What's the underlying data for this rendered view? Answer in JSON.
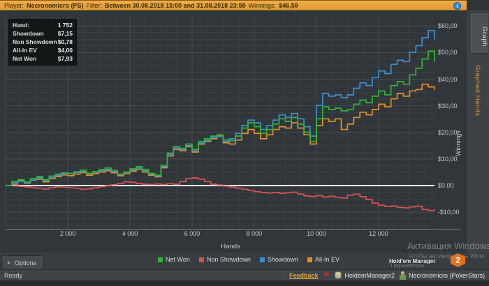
{
  "header": {
    "player_label": "Player:",
    "player_value": "Necronomicro (PS)",
    "filter_label": "Filter:",
    "filter_value": "Between 30.08.2018 15:00 and 31.08.2018 23:59",
    "winnings_label": "Winnings:",
    "winnings_value": "$46,59",
    "info_icon": "i"
  },
  "sidebar": {
    "tabs": [
      {
        "label": "Graph"
      },
      {
        "label": "Graphed Hands"
      }
    ]
  },
  "tooltip": {
    "rows": [
      {
        "label": "Hand:",
        "value": "1 752"
      },
      {
        "label": "Showdown",
        "value": "$7,15"
      },
      {
        "label": "Non Showdown",
        "value": "$0,78"
      },
      {
        "label": "All-In EV",
        "value": "$4,00"
      },
      {
        "label": "Net Won",
        "value": "$7,93"
      }
    ]
  },
  "chart_data": {
    "type": "line",
    "xlabel": "Hands",
    "ylabel": "Winnings",
    "xlim": [
      0,
      13800
    ],
    "ylim": [
      -16,
      64
    ],
    "x_ticks": [
      2000,
      4000,
      6000,
      8000,
      10000,
      12000
    ],
    "x_tick_labels": [
      "2 000",
      "4 000",
      "6 000",
      "8 000",
      "10 000",
      "12 000"
    ],
    "y_ticks": [
      60,
      50,
      40,
      30,
      20,
      10,
      0,
      -10
    ],
    "y_tick_labels": [
      "$60,00",
      "$50,00",
      "$40,00",
      "$30,00",
      "$20,00",
      "$10,00",
      "$0,00",
      "-$10,00"
    ],
    "x_minor_step": 500,
    "y_minor_step": 2.5,
    "grid": true,
    "legend_position": "bottom",
    "zero_line_color": "#ffffff",
    "colors": {
      "grid_minor": "#3a4045",
      "grid_major": "#454c51",
      "axis": "#7b8286"
    },
    "draw_order": [
      1,
      3,
      2,
      0
    ],
    "x": [
      0,
      200,
      400,
      600,
      800,
      1000,
      1200,
      1400,
      1600,
      1800,
      2000,
      2200,
      2400,
      2600,
      2800,
      3000,
      3200,
      3400,
      3600,
      3800,
      4000,
      4200,
      4400,
      4600,
      4800,
      5000,
      5200,
      5400,
      5600,
      5800,
      6000,
      6200,
      6400,
      6600,
      6800,
      7000,
      7200,
      7400,
      7600,
      7800,
      8000,
      8200,
      8400,
      8600,
      8800,
      9000,
      9200,
      9400,
      9600,
      9800,
      10000,
      10200,
      10400,
      10600,
      10800,
      11000,
      11200,
      11400,
      11600,
      11800,
      12000,
      12200,
      12400,
      12600,
      12800,
      13000,
      13200,
      13400,
      13600,
      13800
    ],
    "series": [
      {
        "name": "Net Won",
        "color": "#2eb535",
        "values": [
          0,
          1.5,
          2.2,
          1.4,
          2.6,
          3.4,
          2.2,
          3.6,
          4.3,
          4.8,
          4.4,
          5.2,
          5.8,
          4.6,
          5.3,
          6.0,
          6.6,
          5.6,
          4.3,
          5.1,
          6.3,
          7.1,
          6.1,
          4.6,
          3.9,
          7.6,
          12.2,
          14.6,
          14.0,
          15.6,
          13.6,
          16.6,
          17.6,
          18.6,
          19.1,
          17.1,
          16.9,
          18.6,
          21.6,
          23.6,
          22.1,
          19.6,
          21.1,
          23.1,
          25.1,
          24.1,
          25.6,
          23.1,
          20.1,
          16.6,
          25.1,
          29.6,
          28.6,
          29.1,
          28.1,
          28.6,
          30.6,
          32.1,
          31.1,
          33.6,
          35.6,
          34.1,
          37.6,
          39.1,
          38.1,
          41.6,
          44.1,
          47.6,
          50.6,
          46.5
        ]
      },
      {
        "name": "Non Showdown",
        "color": "#d95252",
        "values": [
          0,
          0.3,
          -0.3,
          -0.5,
          -0.8,
          -1.0,
          -1.3,
          -0.8,
          -0.5,
          -0.6,
          -0.8,
          -1.0,
          -1.4,
          -1.2,
          -0.8,
          -0.4,
          -0.1,
          0.3,
          0.8,
          1.4,
          1.2,
          0.8,
          0.5,
          0.4,
          0.6,
          0.4,
          0.7,
          0.5,
          1.5,
          2.6,
          2.9,
          2.4,
          1.5,
          0.5,
          0.2,
          -0.2,
          -0.6,
          -1.0,
          -1.4,
          -1.8,
          -2.3,
          -2.6,
          -2.8,
          -2.6,
          -2.9,
          -2.7,
          -2.5,
          -3.2,
          -3.9,
          -4.1,
          -3.8,
          -4.3,
          -4.0,
          -4.4,
          -4.7,
          -3.6,
          -3.2,
          -4.2,
          -5.3,
          -6.6,
          -7.4,
          -7.9,
          -7.7,
          -8.2,
          -8.4,
          -8.0,
          -7.8,
          -9.0,
          -9.4,
          -8.8
        ]
      },
      {
        "name": "Showdown",
        "color": "#3e8ed0",
        "values": [
          0,
          0.8,
          1.6,
          1.0,
          2.1,
          2.9,
          1.9,
          3.1,
          3.9,
          4.5,
          4.6,
          4.9,
          5.3,
          4.4,
          5.0,
          5.6,
          6.1,
          5.3,
          4.1,
          4.9,
          5.9,
          6.6,
          5.6,
          4.3,
          3.6,
          7.1,
          11.7,
          14.1,
          13.6,
          15.0,
          13.1,
          16.0,
          17.0,
          18.0,
          18.4,
          16.6,
          17.6,
          19.6,
          22.6,
          24.6,
          23.6,
          21.1,
          22.6,
          24.6,
          26.6,
          25.6,
          27.1,
          25.1,
          22.1,
          18.6,
          30.1,
          34.6,
          33.6,
          34.1,
          33.1,
          34.1,
          36.6,
          38.6,
          37.6,
          40.6,
          43.1,
          42.1,
          45.6,
          47.1,
          46.6,
          50.1,
          52.6,
          55.6,
          58.3,
          55.0
        ]
      },
      {
        "name": "All-In EV",
        "color": "#e38f27",
        "values": [
          0,
          1.0,
          1.8,
          0.9,
          2.0,
          2.4,
          1.4,
          2.7,
          3.4,
          4.0,
          3.7,
          4.3,
          4.9,
          3.9,
          4.5,
          5.1,
          5.6,
          4.8,
          3.7,
          4.4,
          5.4,
          6.1,
          5.1,
          3.9,
          3.3,
          6.7,
          11.1,
          13.6,
          13.1,
          14.6,
          12.6,
          15.6,
          16.6,
          17.6,
          18.6,
          16.1,
          15.6,
          17.1,
          19.6,
          21.1,
          19.6,
          17.6,
          19.1,
          21.1,
          22.1,
          21.6,
          23.6,
          21.6,
          19.1,
          15.6,
          22.6,
          25.1,
          24.1,
          25.1,
          21.1,
          23.1,
          25.6,
          27.6,
          26.6,
          28.6,
          30.6,
          29.6,
          32.6,
          34.6,
          33.6,
          35.6,
          36.1,
          38.1,
          37.1,
          36.0
        ]
      }
    ]
  },
  "bottom": {
    "options_label": "Options",
    "options_chevron": "▲"
  },
  "statusbar": {
    "ready": "Ready",
    "feedback": "Feedback",
    "flag_icon": "⚑",
    "app_name": "HoldemManager2",
    "account": "Necronomicro (PokerStars)"
  },
  "watermark": {
    "line1": "Активация Windows",
    "line2": "Чтобы активировать Wind",
    "line3": "\"Параметры\" .",
    "hm_text": "Hold'em Manager",
    "hm_badge": "2"
  }
}
